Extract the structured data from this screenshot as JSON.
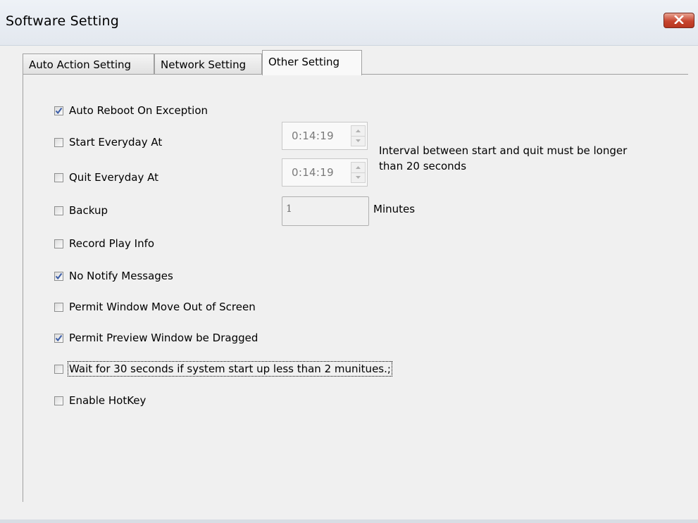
{
  "window": {
    "title": "Software Setting",
    "close_icon": "close-x-icon"
  },
  "tabs": [
    {
      "label": "Auto Action Setting",
      "active": false
    },
    {
      "label": "Network Setting",
      "active": false
    },
    {
      "label": "Other Setting",
      "active": true
    }
  ],
  "options": [
    {
      "label": "Auto Reboot On Exception",
      "checked": true
    },
    {
      "label": "Start Everyday At",
      "checked": false
    },
    {
      "label": "Quit Everyday At",
      "checked": false
    },
    {
      "label": "Backup",
      "checked": false
    },
    {
      "label": "Record Play Info",
      "checked": false
    },
    {
      "label": "No Notify Messages",
      "checked": true
    },
    {
      "label": "Permit Window Move Out of Screen",
      "checked": false
    },
    {
      "label": "Permit Preview Window be Dragged",
      "checked": true
    },
    {
      "label": "Wait for 30 seconds if system start up less than 2 munitues.;",
      "checked": false,
      "focused": true
    },
    {
      "label": "Enable HotKey",
      "checked": false
    }
  ],
  "start_time": {
    "value": "0:14:19",
    "enabled": false
  },
  "quit_time": {
    "value": "0:14:19",
    "enabled": false
  },
  "interval_note": {
    "line1": "Interval between start and quit must be longer",
    "line2": "than 20 seconds"
  },
  "backup": {
    "value": "1",
    "unit_label": "Minutes",
    "enabled": false
  },
  "colors": {
    "check": "#3b5da7",
    "close_button": "#c7452f"
  }
}
